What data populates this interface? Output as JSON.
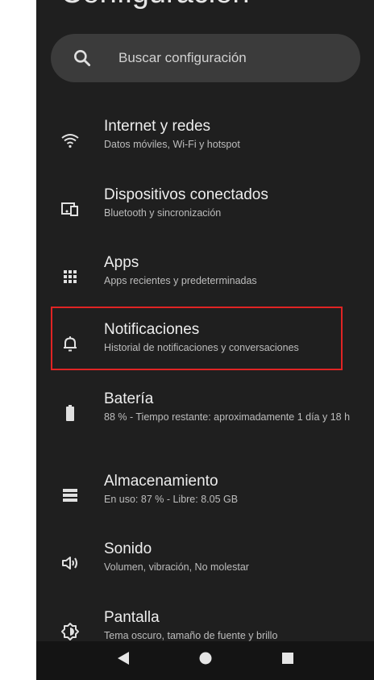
{
  "header": {
    "title": "Configuración"
  },
  "search": {
    "label": "Buscar configuración"
  },
  "settings": [
    {
      "title": "Internet y redes",
      "subtitle": "Datos móviles, Wi-Fi y hotspot",
      "icon": "wifi-icon"
    },
    {
      "title": "Dispositivos conectados",
      "subtitle": "Bluetooth y sincronización",
      "icon": "connected-devices-icon"
    },
    {
      "title": "Apps",
      "subtitle": "Apps recientes y predeterminadas",
      "icon": "apps-grid-icon"
    },
    {
      "title": "Notificaciones",
      "subtitle": "Historial de notificaciones y conversaciones",
      "icon": "bell-icon"
    },
    {
      "title": "Batería",
      "subtitle": "88 % - Tiempo restante: aproximadamente 1 día y 18 h",
      "icon": "battery-icon"
    },
    {
      "title": "Almacenamiento",
      "subtitle": "En uso: 87 % - Libre: 8.05 GB",
      "icon": "storage-icon"
    },
    {
      "title": "Sonido",
      "subtitle": "Volumen, vibración, No molestar",
      "icon": "sound-icon"
    },
    {
      "title": "Pantalla",
      "subtitle": "Tema oscuro, tamaño de fuente y brillo",
      "icon": "display-icon"
    }
  ],
  "colors": {
    "background": "#1f1f1f",
    "search_bg": "#3b3b3b",
    "highlight": "#e02424",
    "navbar": "#141414"
  }
}
